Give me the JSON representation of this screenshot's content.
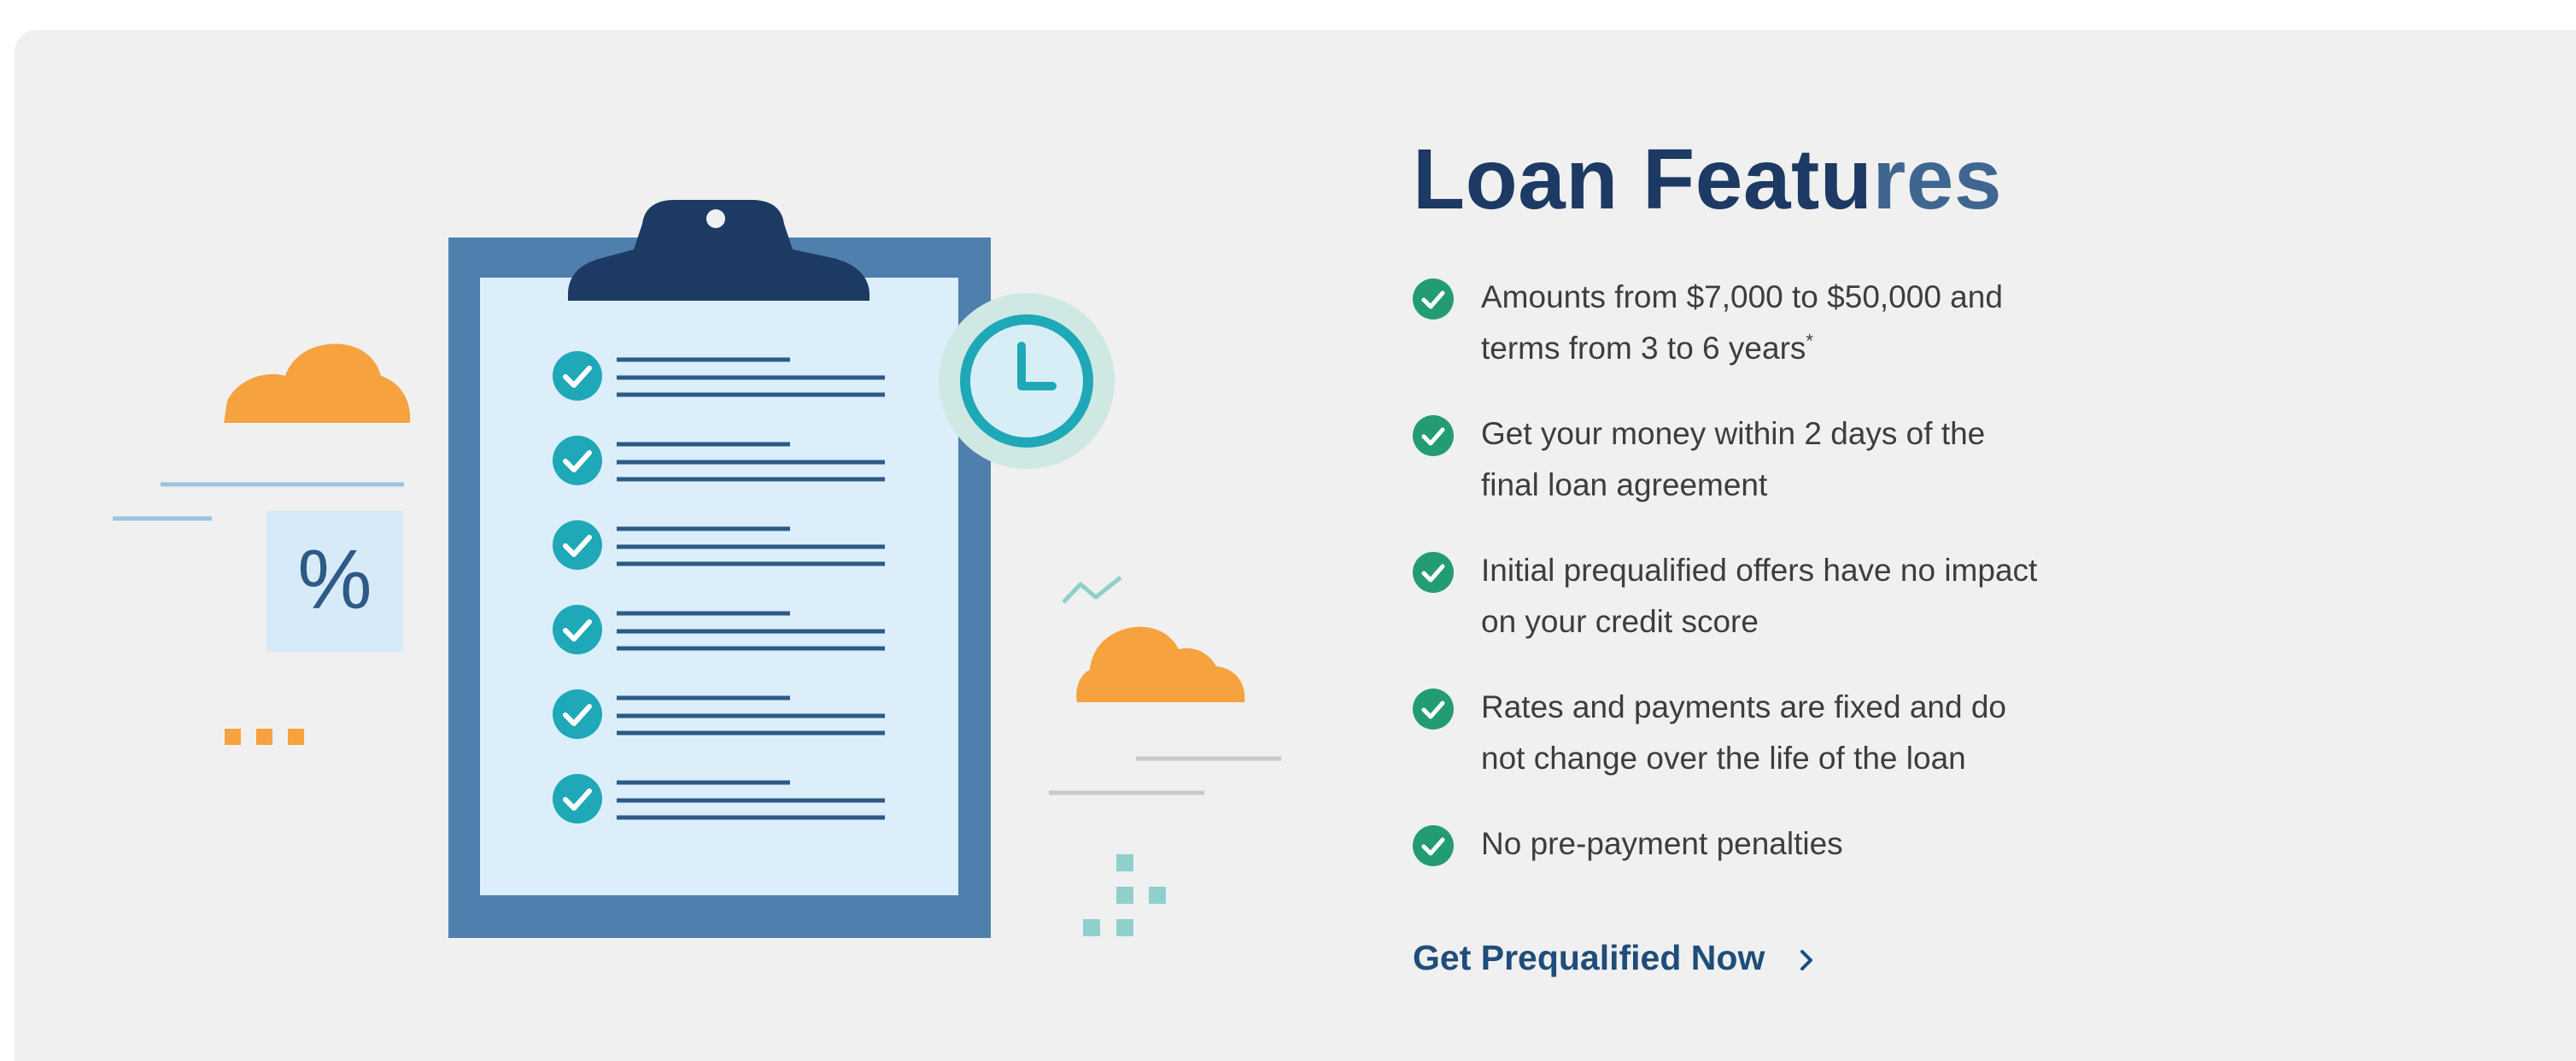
{
  "section": {
    "title_part1": "Loan Featu",
    "title_part2": "res",
    "features": [
      {
        "line1": "Amounts from $7,000 to $50,000 and",
        "line2": "terms from 3 to 6 years",
        "note": "*"
      },
      {
        "line1": "Get your money within 2 days of the",
        "line2": "final loan agreement",
        "note": ""
      },
      {
        "line1": "Initial prequalified offers have no impact",
        "line2": "on your credit score",
        "note": ""
      },
      {
        "line1": "Rates and payments are fixed and do",
        "line2": "not change over the life of the loan",
        "note": ""
      },
      {
        "line1": "No pre-payment penalties",
        "line2": "",
        "note": ""
      }
    ],
    "cta_label": "Get Prequalified Now",
    "percent_symbol": "%"
  },
  "colors": {
    "title": "#1c3a63",
    "check": "#239c74",
    "clipboard_frame": "#4f7fad",
    "clipboard_paper": "#dceefa",
    "clip": "#1c3a63",
    "teal": "#1fa8b7",
    "orange": "#f5a23f",
    "panel": "#f0f0f0"
  },
  "icons": [
    "clipboard-icon",
    "check-icon",
    "clock-icon",
    "cloud-icon",
    "percent-icon",
    "chevron-right-icon"
  ]
}
